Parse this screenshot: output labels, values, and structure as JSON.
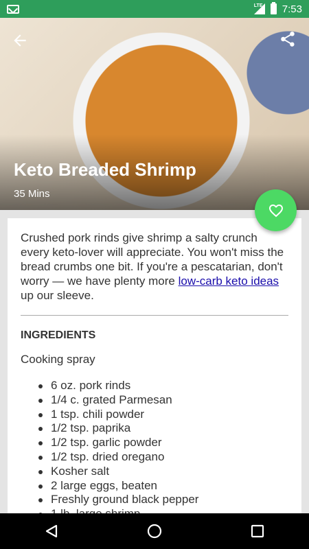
{
  "status": {
    "time": "7:53",
    "network": "LTE"
  },
  "recipe": {
    "title": "Keto Breaded Shrimp",
    "time": "35 Mins",
    "description_before_link": "Crushed pork rinds give shrimp a salty crunch every keto-lover will appreciate. You won't miss the bread crumbs one bit. If you're a pescatarian, don't worry — we have plenty more ",
    "description_link": "low-carb keto ideas",
    "description_after_link": " up our sleeve.",
    "ingredients_heading": "INGREDIENTS",
    "intro_ingredient": "Cooking spray",
    "ingredients": [
      "6 oz. pork rinds",
      "1/4 c. grated Parmesan",
      "1 tsp. chili powder",
      "1/2 tsp. paprika",
      "1/2 tsp. garlic powder",
      "1/2 tsp. dried oregano",
      "Kosher salt",
      "2 large eggs, beaten",
      "Freshly ground black pepper",
      "1 lb. large shrimp"
    ]
  },
  "colors": {
    "status_bar": "#2e9e5b",
    "fab": "#4cd964",
    "link": "#1a0dab"
  },
  "icons": {
    "back": "arrow-left",
    "share": "share",
    "favorite": "heart-outline"
  }
}
